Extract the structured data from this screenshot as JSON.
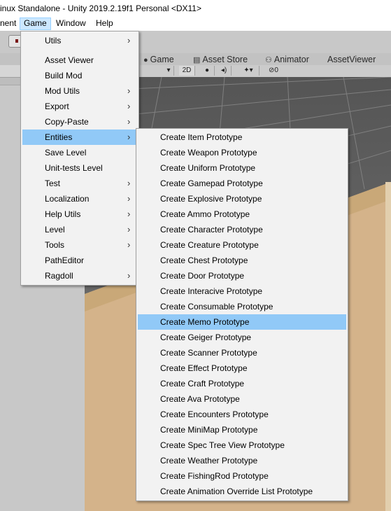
{
  "window": {
    "title": "inux Standalone - Unity 2019.2.19f1 Personal <DX11>"
  },
  "menubar": {
    "items": [
      {
        "label": "nent"
      },
      {
        "label": "Game"
      },
      {
        "label": "Window"
      },
      {
        "label": "Help"
      }
    ]
  },
  "tabs": [
    {
      "label": "Game",
      "icon": "game-controller-icon"
    },
    {
      "label": "Asset Store",
      "icon": "store-icon"
    },
    {
      "label": "Animator",
      "icon": "animator-icon"
    },
    {
      "label": "AssetViewer",
      "icon": ""
    }
  ],
  "scene_toolbar": {
    "mode_2d": "2D",
    "hidden_count": "0",
    "light_icon": "light-bulb-icon",
    "audio_icon": "speaker-icon",
    "effects_icon": "effects-icon",
    "visibility_icon": "eye-slash-icon"
  },
  "game_menu": {
    "items": [
      {
        "label": "Utils",
        "submenu": true
      },
      {
        "label": "Asset Viewer",
        "submenu": false
      },
      {
        "label": "Build Mod",
        "submenu": false
      },
      {
        "label": "Mod Utils",
        "submenu": true
      },
      {
        "label": "Export",
        "submenu": true
      },
      {
        "label": "Copy-Paste",
        "submenu": true
      },
      {
        "label": "Entities",
        "submenu": true,
        "highlighted": true
      },
      {
        "label": "Save Level",
        "submenu": false
      },
      {
        "label": "Unit-tests Level",
        "submenu": false
      },
      {
        "label": "Test",
        "submenu": true
      },
      {
        "label": "Localization",
        "submenu": true
      },
      {
        "label": "Help Utils",
        "submenu": true
      },
      {
        "label": "Level",
        "submenu": true
      },
      {
        "label": "Tools",
        "submenu": true
      },
      {
        "label": "PathEditor",
        "submenu": false
      },
      {
        "label": "Ragdoll",
        "submenu": true
      }
    ]
  },
  "entities_menu": {
    "items": [
      {
        "label": "Create Item Prototype"
      },
      {
        "label": "Create Weapon Prototype"
      },
      {
        "label": "Create Uniform Prototype"
      },
      {
        "label": "Create Gamepad Prototype"
      },
      {
        "label": "Create Explosive Prototype"
      },
      {
        "label": "Create Ammo Prototype"
      },
      {
        "label": "Create Character Prototype"
      },
      {
        "label": "Create Creature Prototype"
      },
      {
        "label": "Create Chest Prototype"
      },
      {
        "label": "Create Door Prototype"
      },
      {
        "label": "Create Interacive Prototype"
      },
      {
        "label": "Create Consumable Prototype"
      },
      {
        "label": "Create Memo Prototype",
        "highlighted": true
      },
      {
        "label": "Create Geiger Prototype"
      },
      {
        "label": "Create Scanner Prototype"
      },
      {
        "label": "Create Effect Prototype"
      },
      {
        "label": "Create Craft Prototype"
      },
      {
        "label": "Create Ava Prototype"
      },
      {
        "label": "Create Encounters Prototype"
      },
      {
        "label": "Create MiniMap Prototype"
      },
      {
        "label": "Create Spec Tree View Prototype"
      },
      {
        "label": "Create Weather Prototype"
      },
      {
        "label": "Create FishingRod Prototype"
      },
      {
        "label": "Create Animation Override List Prototype"
      }
    ]
  },
  "colors": {
    "menu_highlight": "#91c9f7",
    "menubar_open": "#cce8ff",
    "sand": "#d4b38a",
    "grid_floor": "#6b6b6b"
  },
  "icons": {
    "submenu_arrow": "chevron-right-icon",
    "submenu_arrow_glyph": "›"
  }
}
